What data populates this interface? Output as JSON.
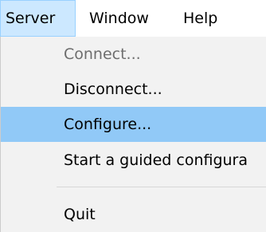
{
  "menubar": {
    "items": [
      {
        "label": "Server",
        "state": "open"
      },
      {
        "label": "Window"
      },
      {
        "label": "Help"
      }
    ]
  },
  "server_menu": {
    "items": [
      {
        "label": "Connect...",
        "enabled": false
      },
      {
        "label": "Disconnect...",
        "enabled": true
      },
      {
        "label": "Configure...",
        "enabled": true,
        "hovered": true
      },
      {
        "label": "Start a guided configura",
        "enabled": true
      },
      {
        "label": "Quit",
        "enabled": true
      }
    ]
  },
  "colors": {
    "menubar_open_bg": "#cce8ff",
    "menubar_open_border": "#99d1ff",
    "menu_bg": "#f2f2f2",
    "hover_bg": "#91c9f7",
    "disabled_text": "#6d6d6d",
    "separator": "#d7d7d7"
  }
}
